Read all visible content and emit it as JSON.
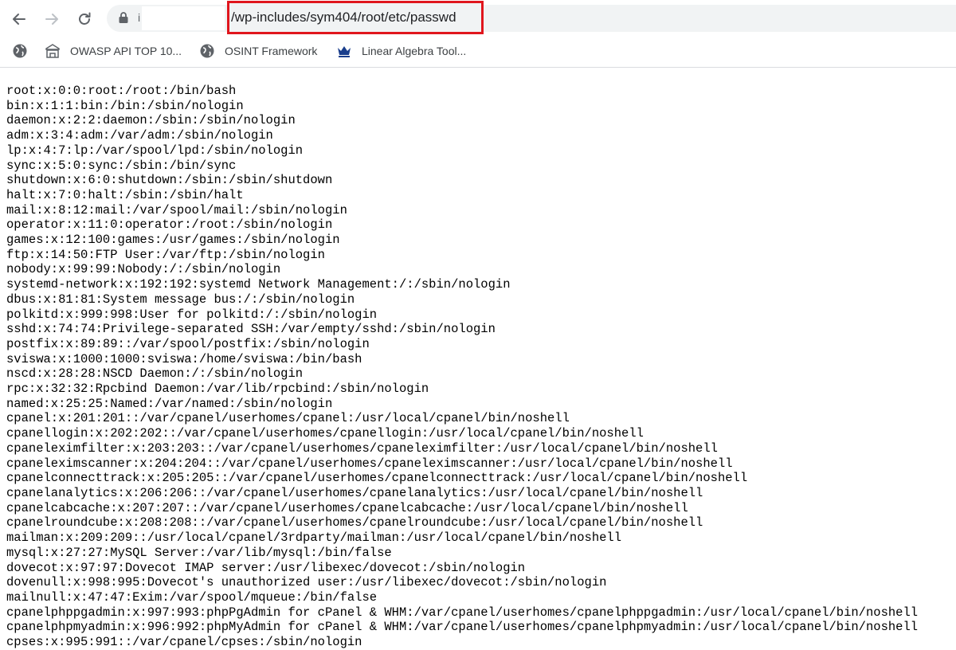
{
  "browser": {
    "address": {
      "host_visible": "i",
      "path": "/wp-includes/sym404/root/etc/passwd"
    },
    "bookmarks": [
      {
        "label": "",
        "icon": "globe-icon"
      },
      {
        "label": "OWASP API TOP 10...",
        "icon": "building-icon"
      },
      {
        "label": "OSINT Framework",
        "icon": "globe-icon"
      },
      {
        "label": "Linear Algebra Tool...",
        "icon": "crown-icon"
      }
    ],
    "highlight_color": "#e0161d"
  },
  "file": {
    "lines": [
      "root:x:0:0:root:/root:/bin/bash",
      "bin:x:1:1:bin:/bin:/sbin/nologin",
      "daemon:x:2:2:daemon:/sbin:/sbin/nologin",
      "adm:x:3:4:adm:/var/adm:/sbin/nologin",
      "lp:x:4:7:lp:/var/spool/lpd:/sbin/nologin",
      "sync:x:5:0:sync:/sbin:/bin/sync",
      "shutdown:x:6:0:shutdown:/sbin:/sbin/shutdown",
      "halt:x:7:0:halt:/sbin:/sbin/halt",
      "mail:x:8:12:mail:/var/spool/mail:/sbin/nologin",
      "operator:x:11:0:operator:/root:/sbin/nologin",
      "games:x:12:100:games:/usr/games:/sbin/nologin",
      "ftp:x:14:50:FTP User:/var/ftp:/sbin/nologin",
      "nobody:x:99:99:Nobody:/:/sbin/nologin",
      "systemd-network:x:192:192:systemd Network Management:/:/sbin/nologin",
      "dbus:x:81:81:System message bus:/:/sbin/nologin",
      "polkitd:x:999:998:User for polkitd:/:/sbin/nologin",
      "sshd:x:74:74:Privilege-separated SSH:/var/empty/sshd:/sbin/nologin",
      "postfix:x:89:89::/var/spool/postfix:/sbin/nologin",
      "sviswa:x:1000:1000:sviswa:/home/sviswa:/bin/bash",
      "nscd:x:28:28:NSCD Daemon:/:/sbin/nologin",
      "rpc:x:32:32:Rpcbind Daemon:/var/lib/rpcbind:/sbin/nologin",
      "named:x:25:25:Named:/var/named:/sbin/nologin",
      "cpanel:x:201:201::/var/cpanel/userhomes/cpanel:/usr/local/cpanel/bin/noshell",
      "cpanellogin:x:202:202::/var/cpanel/userhomes/cpanellogin:/usr/local/cpanel/bin/noshell",
      "cpaneleximfilter:x:203:203::/var/cpanel/userhomes/cpaneleximfilter:/usr/local/cpanel/bin/noshell",
      "cpaneleximscanner:x:204:204::/var/cpanel/userhomes/cpaneleximscanner:/usr/local/cpanel/bin/noshell",
      "cpanelconnecttrack:x:205:205::/var/cpanel/userhomes/cpanelconnecttrack:/usr/local/cpanel/bin/noshell",
      "cpanelanalytics:x:206:206::/var/cpanel/userhomes/cpanelanalytics:/usr/local/cpanel/bin/noshell",
      "cpanelcabcache:x:207:207::/var/cpanel/userhomes/cpanelcabcache:/usr/local/cpanel/bin/noshell",
      "cpanelroundcube:x:208:208::/var/cpanel/userhomes/cpanelroundcube:/usr/local/cpanel/bin/noshell",
      "mailman:x:209:209::/usr/local/cpanel/3rdparty/mailman:/usr/local/cpanel/bin/noshell",
      "mysql:x:27:27:MySQL Server:/var/lib/mysql:/bin/false",
      "dovecot:x:97:97:Dovecot IMAP server:/usr/libexec/dovecot:/sbin/nologin",
      "dovenull:x:998:995:Dovecot's unauthorized user:/usr/libexec/dovecot:/sbin/nologin",
      "mailnull:x:47:47:Exim:/var/spool/mqueue:/bin/false",
      "cpanelphppgadmin:x:997:993:phpPgAdmin for cPanel & WHM:/var/cpanel/userhomes/cpanelphppgadmin:/usr/local/cpanel/bin/noshell",
      "cpanelphpmyadmin:x:996:992:phpMyAdmin for cPanel & WHM:/var/cpanel/userhomes/cpanelphpmyadmin:/usr/local/cpanel/bin/noshell",
      "cpses:x:995:991::/var/cpanel/cpses:/sbin/nologin"
    ]
  }
}
